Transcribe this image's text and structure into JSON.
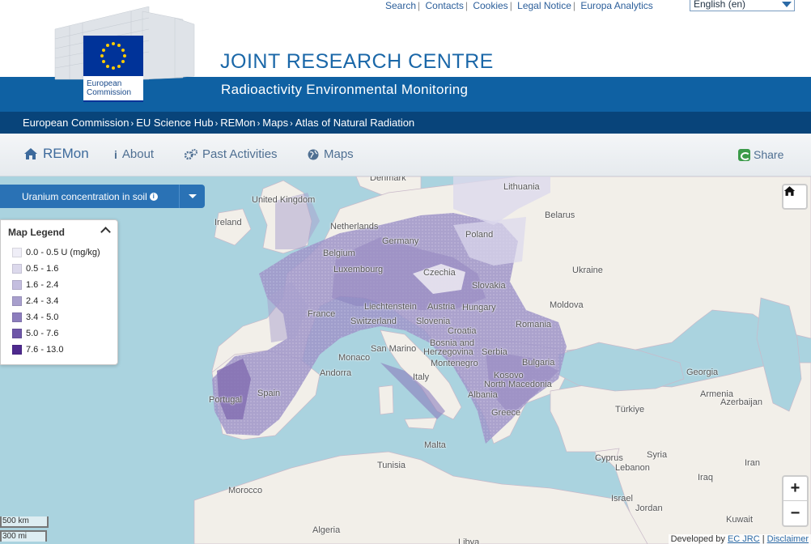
{
  "toplinks": {
    "search": "Search",
    "contacts": "Contacts",
    "cookies": "Cookies",
    "legal": "Legal Notice",
    "analytics": "Europa Analytics"
  },
  "language": "English (en)",
  "logo": {
    "line1": "European",
    "line2": "Commission"
  },
  "header": {
    "title": "JOINT RESEARCH CENTRE",
    "subtitle": "Radioactivity Environmental Monitoring"
  },
  "breadcrumb": [
    "European Commission",
    "EU Science Hub",
    "REMon",
    "Maps",
    "Atlas of Natural Radiation"
  ],
  "nav": {
    "brand": "REMon",
    "about": "About",
    "past": "Past Activities",
    "maps": "Maps",
    "share": "Share"
  },
  "layer": {
    "label": "Uranium concentration in soil"
  },
  "legend": {
    "title": "Map Legend",
    "items": [
      {
        "label": "0.0 - 0.5 U (mg/kg)",
        "color": "#efeef7"
      },
      {
        "label": "0.5 - 1.6",
        "color": "#dcd9ec"
      },
      {
        "label": "1.6 - 2.4",
        "color": "#c4bedf"
      },
      {
        "label": "2.4 - 3.4",
        "color": "#a89fcd"
      },
      {
        "label": "3.4 - 5.0",
        "color": "#8c7dbd"
      },
      {
        "label": "5.0 - 7.6",
        "color": "#6e56a8"
      },
      {
        "label": "7.6 - 13.0",
        "color": "#4e2a8e"
      }
    ]
  },
  "map_labels": {
    "denmark": "Denmark",
    "lithuania": "Lithuania",
    "uk": "United Kingdom",
    "belarus": "Belarus",
    "ireland": "Ireland",
    "netherlands": "Netherlands",
    "poland": "Poland",
    "germany": "Germany",
    "belgium": "Belgium",
    "luxembourg": "Luxembourg",
    "czechia": "Czechia",
    "ukraine": "Ukraine",
    "slovakia": "Slovakia",
    "france": "France",
    "liechtenstein": "Liechtenstein",
    "austria": "Austria",
    "hungary": "Hungary",
    "moldova": "Moldova",
    "switzerland": "Switzerland",
    "slovenia": "Slovenia",
    "romania": "Romania",
    "croatia": "Croatia",
    "sanmarino": "San Marino",
    "bih1": "Bosnia and",
    "bih2": "Herzegovina",
    "serbia": "Serbia",
    "monaco": "Monaco",
    "montenegro": "Montenegro",
    "bulgaria": "Bulgaria",
    "andorra": "Andorra",
    "kosovo": "Kosovo",
    "northmacedonia": "North Macedonia",
    "georgia": "Georgia",
    "italy": "Italy",
    "portugal": "Portugal",
    "spain": "Spain",
    "albania": "Albania",
    "armenia": "Armenia",
    "azerbaijan": "Azerbaijan",
    "greece": "Greece",
    "turkiye": "Türkiye",
    "malta": "Malta",
    "cyprus": "Cyprus",
    "syria": "Syria",
    "lebanon": "Lebanon",
    "iran": "Iran",
    "tunisia": "Tunisia",
    "iraq": "Iraq",
    "morocco": "Morocco",
    "israel": "Israel",
    "jordan": "Jordan",
    "kuwait": "Kuwait",
    "algeria": "Algeria",
    "libya": "Libya"
  },
  "scale": {
    "km": "500 km",
    "mi": "300 mi"
  },
  "attribution": {
    "prefix": "Developed by",
    "link1": "EC JRC",
    "sep": "|",
    "link2": "Disclaimer"
  },
  "zoom": {
    "in": "+",
    "out": "−"
  },
  "colors": {
    "header_blue": "#0f61a3",
    "breadcrumb_blue": "#08447a",
    "sea": "#aad3df",
    "land": "#f2efe9"
  }
}
